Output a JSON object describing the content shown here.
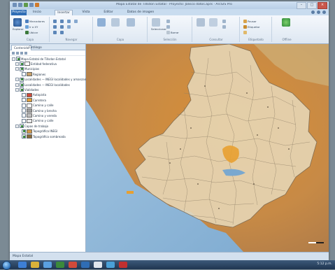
{
  "window": {
    "title": "Mapa Estatal de Tillsdon Estatal · Proyecto: Jalisco datos.aprx · ArcGIS Pro"
  },
  "tabs": [
    {
      "label": "Proyecto"
    },
    {
      "label": "Inicio"
    },
    {
      "label": "Insertar"
    },
    {
      "label": "Vista"
    },
    {
      "label": "Editar"
    },
    {
      "label": "Datos de imagen"
    }
  ],
  "ribbon": {
    "groups": [
      {
        "label": "Capa"
      },
      {
        "label": "Navegar"
      },
      {
        "label": "Capa"
      },
      {
        "label": "Selección"
      },
      {
        "label": "Consultar"
      },
      {
        "label": "Etiquetado"
      },
      {
        "label": "Offline"
      }
    ],
    "explore_label": "Explorar",
    "select_label": "Seleccionar",
    "small_buttons": [
      "Marcadores",
      "Ir a XY",
      "Ubicar",
      "Borrar",
      "Pausar",
      "Etiquetar"
    ]
  },
  "contents": {
    "tabs": [
      "Contenido",
      "Catálogo"
    ],
    "layers": [
      {
        "label": "Mapa Estatal de Tillsdon Estatal",
        "level": 0,
        "checked": true,
        "swatch": ""
      },
      {
        "label": "Entidad federativa",
        "level": 1,
        "checked": true,
        "swatch": "#ffffff"
      },
      {
        "label": "Municipios",
        "level": 1,
        "checked": true,
        "swatch": ""
      },
      {
        "label": "Regiones",
        "level": 2,
        "checked": false,
        "swatch": "#c7a06a"
      },
      {
        "label": "Localidades — INEGI localidades y amanzanadas",
        "level": 1,
        "checked": true,
        "swatch": ""
      },
      {
        "label": "Localidades — INEGI localidades",
        "level": 1,
        "checked": true,
        "swatch": ""
      },
      {
        "label": "Vialidades",
        "level": 1,
        "checked": true,
        "swatch": ""
      },
      {
        "label": "Autopista",
        "level": 2,
        "checked": false,
        "swatch": "#d04a3a"
      },
      {
        "label": "Carretera",
        "level": 2,
        "checked": false,
        "swatch": "#e0a03a"
      },
      {
        "label": "Camino y calle",
        "level": 2,
        "checked": false,
        "swatch": "#ffffff"
      },
      {
        "label": "Camino y brecha",
        "level": 2,
        "checked": false,
        "swatch": "#a0a0a0"
      },
      {
        "label": "Camino y vereda",
        "level": 2,
        "checked": false,
        "swatch": "#c0c0c0"
      },
      {
        "label": "Camino y calle",
        "level": 2,
        "checked": false,
        "swatch": "#e8e8e8"
      },
      {
        "label": "Capas de trabajo",
        "level": 1,
        "checked": true,
        "swatch": ""
      },
      {
        "label": "Topográfica INEGI",
        "level": 2,
        "checked": true,
        "swatch": "#d29a4a"
      },
      {
        "label": "Topográfica sombreada",
        "level": 2,
        "checked": true,
        "swatch": "#8a6a3a"
      }
    ]
  },
  "map": {
    "scale_label": ""
  },
  "status": {
    "text": "Mapa Estatal"
  },
  "taskbar": {
    "time": "5:12 p.m."
  },
  "colors": {
    "accent": "#2f6db5",
    "terrain": "#e39a3a",
    "water": "#8fb7d8"
  }
}
